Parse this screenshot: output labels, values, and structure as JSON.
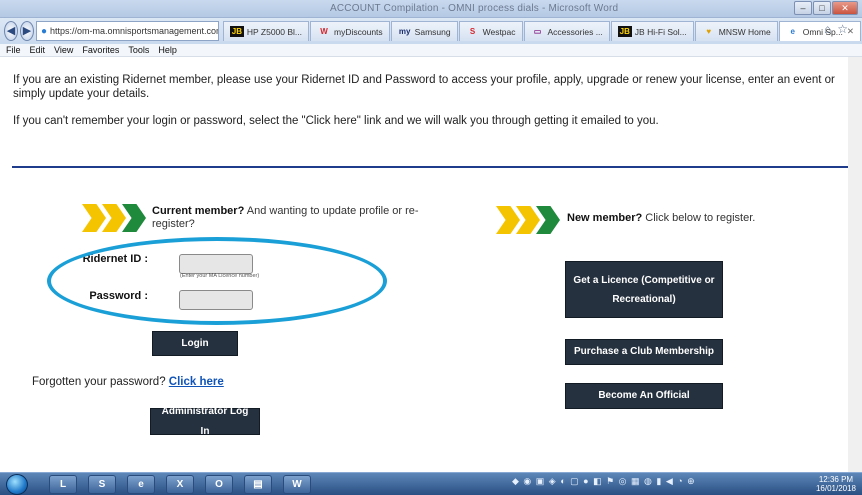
{
  "browser": {
    "window_title": "ACCOUNT Compilation - OMNI process dials - Microsoft Word",
    "url": "https://om-ma.omnisportsmanagement.com/Me",
    "tabs": [
      {
        "icon": "JB",
        "label": "HP Z5000 Bl..."
      },
      {
        "icon": "W",
        "label": "myDiscounts"
      },
      {
        "icon": "my",
        "label": "Samsung"
      },
      {
        "icon": "S",
        "label": "Westpac"
      },
      {
        "icon": "▭",
        "label": "Accessories ..."
      },
      {
        "icon": "JB",
        "label": "JB Hi-Fi Sol..."
      },
      {
        "icon": "♥",
        "label": "MNSW Home"
      },
      {
        "icon": "e",
        "label": "Omni Sp..."
      }
    ],
    "menu": [
      "File",
      "Edit",
      "View",
      "Favorites",
      "Tools",
      "Help"
    ]
  },
  "page": {
    "intro1": "If you are an existing Ridernet member, please use your Ridernet ID and Password to access your profile, apply, upgrade or renew your license, enter an event or simply update your details.",
    "intro2": "If you can't remember your login or password, select the \"Click here\" link and we will walk you through getting it emailed to you.",
    "current": {
      "bold": "Current member?",
      "rest": " And wanting to update profile or re-register?"
    },
    "new_member": {
      "bold": "New member?",
      "rest": " Click below to register."
    },
    "ridernet_label": "Ridernet ID :",
    "password_label": "Password :",
    "licence_hint": "Enter your MA Licence number",
    "login_btn": "Login",
    "forgot_text": "Forgotten your password? ",
    "forgot_link": "Click here",
    "admin_btn": "Administrator Log In",
    "licence_btn": "Get a Licence (Competitive or Recreational)",
    "club_btn": "Purchase a Club Membership",
    "official_btn": "Become An Official"
  },
  "taskbar": {
    "apps": [
      "L",
      "S",
      "e",
      "X",
      "O",
      "▤",
      "W"
    ],
    "time": "12:36 PM",
    "date": "16/01/2018"
  },
  "colors": {
    "divider": "#1f3c8c",
    "chevron_yellow": "#f5c400",
    "chevron_green": "#1f8a3c",
    "button_dark": "#26313f",
    "highlight_oval": "#1a9fd6",
    "link": "#1054b8"
  }
}
